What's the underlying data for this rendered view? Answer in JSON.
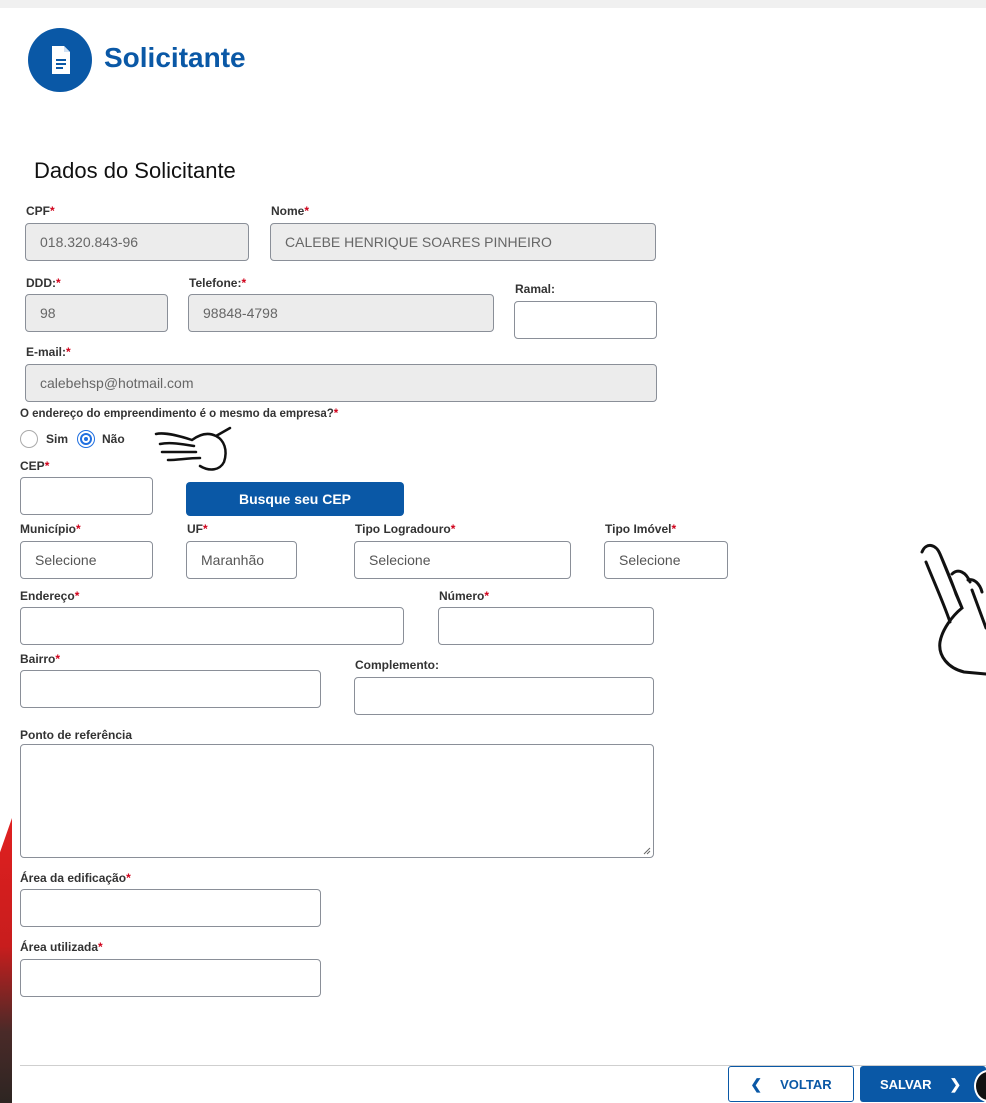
{
  "header": {
    "title": "Solicitante",
    "icon": "document-icon"
  },
  "section_title": "Dados do Solicitante",
  "required_mark": "*",
  "fields": {
    "cpf": {
      "label": "CPF",
      "value": "018.320.843-96"
    },
    "nome": {
      "label": "Nome",
      "value": "CALEBE HENRIQUE SOARES PINHEIRO"
    },
    "ddd": {
      "label": "DDD:",
      "value": "98"
    },
    "telefone": {
      "label": "Telefone:",
      "value": "98848-4798"
    },
    "ramal": {
      "label": "Ramal:",
      "value": ""
    },
    "email": {
      "label": "E-mail:",
      "value": "calebehsp@hotmail.com"
    },
    "question": {
      "label": "O endereço do empreendimento é o mesmo da empresa?"
    },
    "radio_sim": "Sim",
    "radio_nao": "Não",
    "cep": {
      "label": "CEP",
      "value": ""
    },
    "cep_button": "Busque seu CEP",
    "municipio": {
      "label": "Município",
      "value": "Selecione"
    },
    "uf": {
      "label": "UF",
      "value": "Maranhão"
    },
    "tipo_logradouro": {
      "label": "Tipo Logradouro",
      "value": "Selecione"
    },
    "tipo_imovel": {
      "label": "Tipo Imóvel",
      "value": "Selecione"
    },
    "endereco": {
      "label": "Endereço",
      "value": ""
    },
    "numero": {
      "label": "Número",
      "value": ""
    },
    "bairro": {
      "label": "Bairro",
      "value": ""
    },
    "complemento": {
      "label": "Complemento:",
      "value": ""
    },
    "ponto_referencia": {
      "label": "Ponto de referência",
      "value": ""
    },
    "area_edificacao": {
      "label": "Área da edificação",
      "value": ""
    },
    "area_utilizada": {
      "label": "Área utilizada",
      "value": ""
    }
  },
  "footer": {
    "back_label": "VOLTAR",
    "save_label": "SALVAR"
  },
  "colors": {
    "primary": "#0a58a6",
    "required": "#d0021b",
    "radio_selected": "#1f6fe0"
  }
}
